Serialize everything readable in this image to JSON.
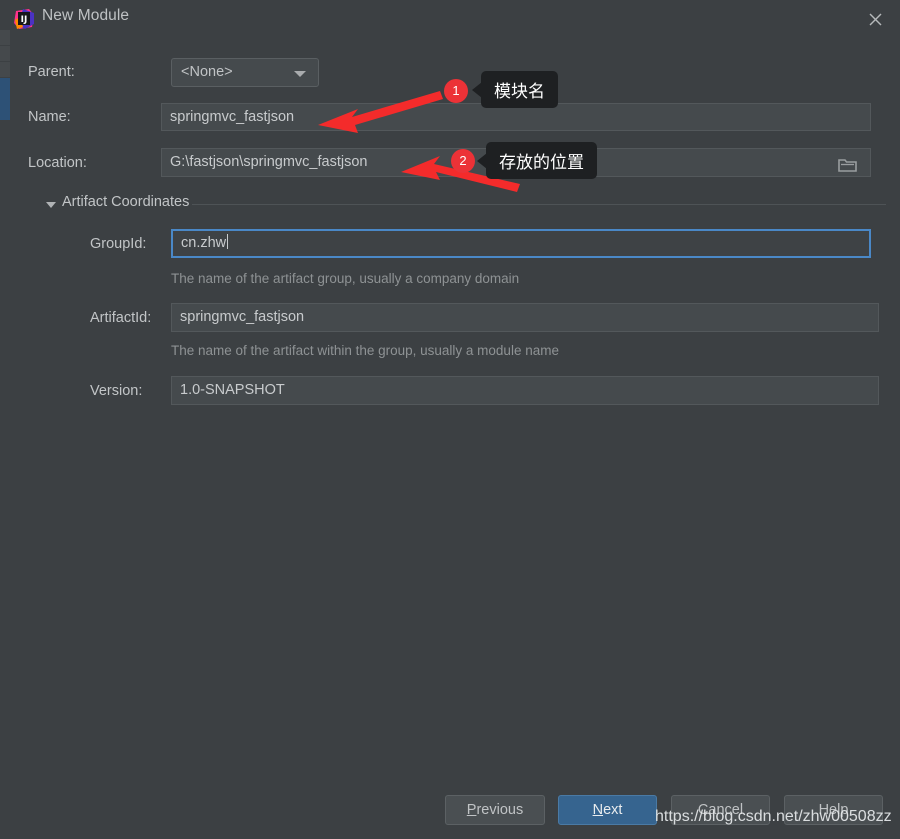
{
  "window": {
    "title": "New Module",
    "app_icon": "intellij-idea-icon",
    "close_icon": "close-icon"
  },
  "form": {
    "parent": {
      "label": "Parent:",
      "value": "<None>",
      "arrow_icon": "chevron-down-icon"
    },
    "name": {
      "label": "Name:",
      "value": "springmvc_fastjson"
    },
    "location": {
      "label": "Location:",
      "value": "G:\\fastjson\\springmvc_fastjson",
      "browse_icon": "folder-icon"
    }
  },
  "artifact_section": {
    "title": "Artifact Coordinates",
    "collapse_icon": "triangle-down-icon",
    "group_id": {
      "label": "GroupId:",
      "value": "cn.zhw",
      "hint": "The name of the artifact group, usually a company domain",
      "focused": true
    },
    "artifact_id": {
      "label": "ArtifactId:",
      "value": "springmvc_fastjson",
      "hint": "The name of the artifact within the group, usually a module name"
    },
    "version": {
      "label": "Version:",
      "value": "1.0-SNAPSHOT"
    }
  },
  "buttons": {
    "previous": {
      "label": "Previous",
      "mnemonic": "P",
      "rest": "revious"
    },
    "next": {
      "label": "Next",
      "mnemonic": "N",
      "rest": "ext"
    },
    "cancel": {
      "label": "Cancel"
    },
    "help": {
      "label": "Help"
    }
  },
  "annotations": [
    {
      "number": "1",
      "text": "模块名"
    },
    {
      "number": "2",
      "text": "存放的位置"
    }
  ],
  "watermark": "https://blog.csdn.net/zhw00508zz",
  "colors": {
    "dialog_bg": "#3c4043",
    "field_bg": "#454a4d",
    "focus_border": "#4a88c7",
    "primary_button": "#36648f",
    "annotation_red": "#ec3237",
    "callout_bg": "#1e2022"
  }
}
